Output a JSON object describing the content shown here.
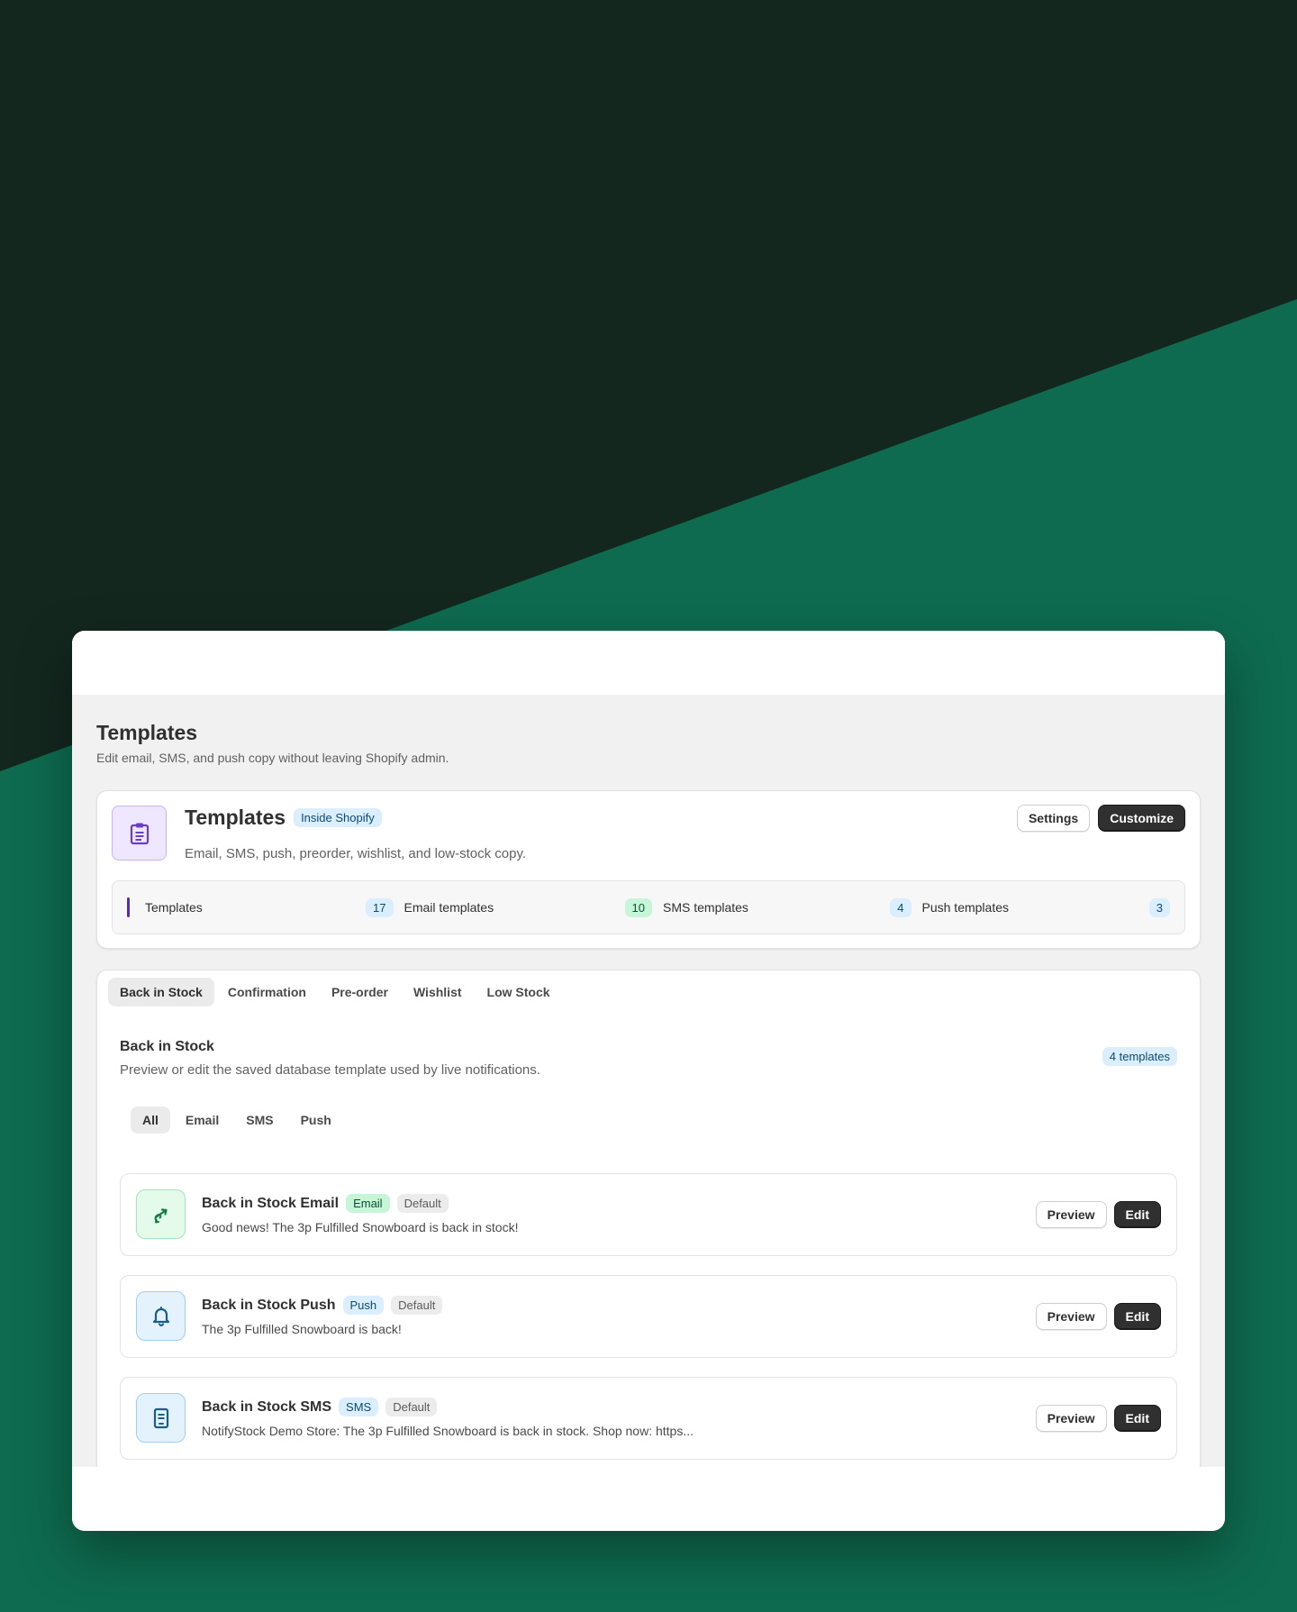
{
  "colors": {
    "background_dark": "#13271f",
    "background_green": "#0e6b4f",
    "accent_purple": "#5b2ea6",
    "primary_button": "#303030"
  },
  "page": {
    "title": "Templates",
    "subtitle": "Edit email, SMS, and push copy without leaving Shopify admin."
  },
  "hero": {
    "icon": "clipboard-icon",
    "title": "Templates",
    "badge": "Inside Shopify",
    "description": "Email, SMS, push, preorder, wishlist, and low-stock copy.",
    "settings_label": "Settings",
    "customize_label": "Customize",
    "stats": [
      {
        "label": "Templates",
        "value": "17"
      },
      {
        "label": "Email templates",
        "value": "10"
      },
      {
        "label": "SMS templates",
        "value": "4"
      },
      {
        "label": "Push templates",
        "value": "3"
      }
    ]
  },
  "tabs": [
    {
      "label": "Back in Stock",
      "active": true
    },
    {
      "label": "Confirmation"
    },
    {
      "label": "Pre-order"
    },
    {
      "label": "Wishlist"
    },
    {
      "label": "Low Stock"
    }
  ],
  "section": {
    "title": "Back in Stock",
    "subtitle": "Preview or edit the saved database template used by live notifications.",
    "count": "4 templates"
  },
  "filters": [
    {
      "label": "All",
      "active": true
    },
    {
      "label": "Email"
    },
    {
      "label": "SMS"
    },
    {
      "label": "Push"
    }
  ],
  "templates": [
    {
      "name": "Back in Stock Email",
      "type": "Email",
      "status": "Default",
      "preview": "Good news! The 3p Fulfilled Snowboard is back in stock!",
      "icon": "email-icon",
      "preview_label": "Preview",
      "edit_label": "Edit"
    },
    {
      "name": "Back in Stock Push",
      "type": "Push",
      "status": "Default",
      "preview": "The 3p Fulfilled Snowboard is back!",
      "icon": "bell-icon",
      "preview_label": "Preview",
      "edit_label": "Edit"
    },
    {
      "name": "Back in Stock SMS",
      "type": "SMS",
      "status": "Default",
      "preview": "NotifyStock Demo Store: The 3p Fulfilled Snowboard is back in stock. Shop now: https...",
      "icon": "sms-icon",
      "preview_label": "Preview",
      "edit_label": "Edit"
    }
  ]
}
